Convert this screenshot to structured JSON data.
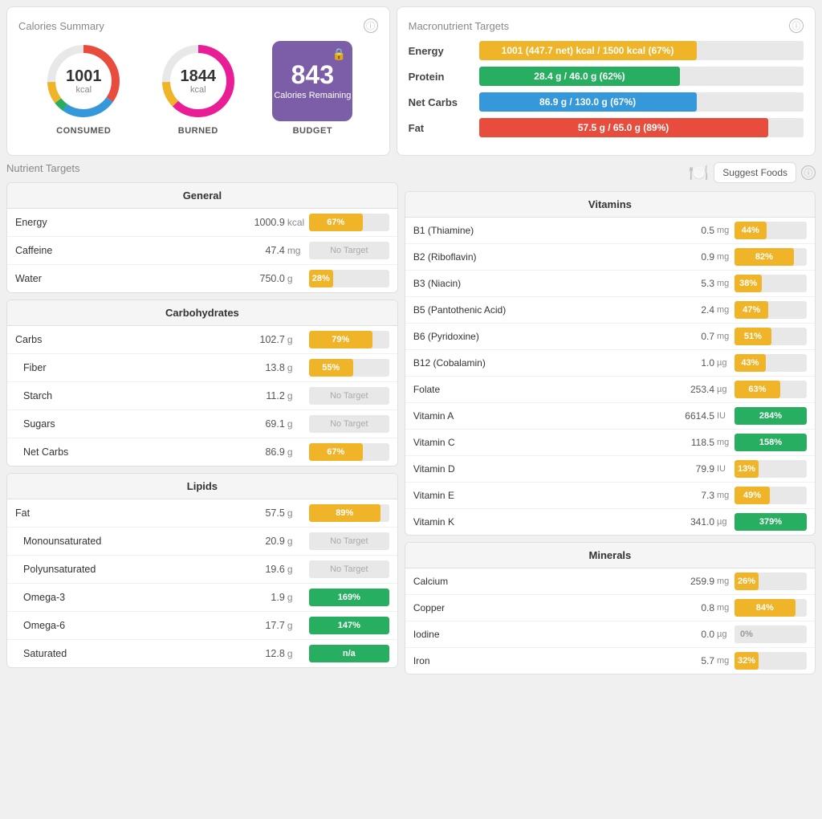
{
  "calories_summary": {
    "title": "Calories Summary",
    "info": "i",
    "consumed": {
      "value": "1001",
      "unit": "kcal",
      "label": "CONSUMED"
    },
    "burned": {
      "value": "1844",
      "unit": "kcal",
      "label": "BURNED"
    },
    "budget": {
      "value": "843",
      "text": "Calories Remaining",
      "label": "BUDGET"
    }
  },
  "macronutrient_targets": {
    "title": "Macronutrient Targets",
    "info": "i",
    "rows": [
      {
        "label": "Energy",
        "text": "1001 (447.7 net) kcal / 1500 kcal (67%)",
        "pct": 67,
        "color": "#f0b429"
      },
      {
        "label": "Protein",
        "text": "28.4 g / 46.0 g (62%)",
        "pct": 62,
        "color": "#27ae60"
      },
      {
        "label": "Net Carbs",
        "text": "86.9 g / 130.0 g (67%)",
        "pct": 67,
        "color": "#3498db"
      },
      {
        "label": "Fat",
        "text": "57.5 g / 65.0 g (89%)",
        "pct": 89,
        "color": "#e74c3c"
      }
    ]
  },
  "nutrient_targets": {
    "title": "Nutrient Targets",
    "suggest_foods": "Suggest Foods",
    "general": {
      "header": "General",
      "rows": [
        {
          "name": "Energy",
          "value": "1000.9",
          "unit": "kcal",
          "pct": 67,
          "color": "#f0b429",
          "indented": false
        },
        {
          "name": "Caffeine",
          "value": "47.4",
          "unit": "mg",
          "no_target": true,
          "indented": false
        },
        {
          "name": "Water",
          "value": "750.0",
          "unit": "g",
          "pct": 28,
          "color": "#f0b429",
          "indented": false
        }
      ]
    },
    "carbohydrates": {
      "header": "Carbohydrates",
      "rows": [
        {
          "name": "Carbs",
          "value": "102.7",
          "unit": "g",
          "pct": 79,
          "color": "#f0b429",
          "indented": false
        },
        {
          "name": "Fiber",
          "value": "13.8",
          "unit": "g",
          "pct": 55,
          "color": "#f0b429",
          "indented": true
        },
        {
          "name": "Starch",
          "value": "11.2",
          "unit": "g",
          "no_target": true,
          "indented": true
        },
        {
          "name": "Sugars",
          "value": "69.1",
          "unit": "g",
          "no_target": true,
          "indented": true
        },
        {
          "name": "Net Carbs",
          "value": "86.9",
          "unit": "g",
          "pct": 67,
          "color": "#f0b429",
          "indented": true
        }
      ]
    },
    "lipids": {
      "header": "Lipids",
      "rows": [
        {
          "name": "Fat",
          "value": "57.5",
          "unit": "g",
          "pct": 89,
          "color": "#f0b429",
          "indented": false
        },
        {
          "name": "Monounsaturated",
          "value": "20.9",
          "unit": "g",
          "no_target": true,
          "indented": true
        },
        {
          "name": "Polyunsaturated",
          "value": "19.6",
          "unit": "g",
          "no_target": true,
          "indented": true
        },
        {
          "name": "Omega-3",
          "value": "1.9",
          "unit": "g",
          "pct": 169,
          "color": "#27ae60",
          "indented": true
        },
        {
          "name": "Omega-6",
          "value": "17.7",
          "unit": "g",
          "pct": 147,
          "color": "#27ae60",
          "indented": true
        },
        {
          "name": "Saturated",
          "value": "12.8",
          "unit": "g",
          "na": true,
          "color": "#27ae60",
          "indented": true
        }
      ]
    }
  },
  "vitamins": {
    "header": "Vitamins",
    "rows": [
      {
        "name": "B1 (Thiamine)",
        "value": "0.5",
        "unit": "mg",
        "pct": 44,
        "color": "#f0b429"
      },
      {
        "name": "B2 (Riboflavin)",
        "value": "0.9",
        "unit": "mg",
        "pct": 82,
        "color": "#f0b429"
      },
      {
        "name": "B3 (Niacin)",
        "value": "5.3",
        "unit": "mg",
        "pct": 38,
        "color": "#f0b429"
      },
      {
        "name": "B5 (Pantothenic Acid)",
        "value": "2.4",
        "unit": "mg",
        "pct": 47,
        "color": "#f0b429"
      },
      {
        "name": "B6 (Pyridoxine)",
        "value": "0.7",
        "unit": "mg",
        "pct": 51,
        "color": "#f0b429"
      },
      {
        "name": "B12 (Cobalamin)",
        "value": "1.0",
        "unit": "µg",
        "pct": 43,
        "color": "#f0b429"
      },
      {
        "name": "Folate",
        "value": "253.4",
        "unit": "µg",
        "pct": 63,
        "color": "#f0b429"
      },
      {
        "name": "Vitamin A",
        "value": "6614.5",
        "unit": "IU",
        "pct": 284,
        "color": "#27ae60"
      },
      {
        "name": "Vitamin C",
        "value": "118.5",
        "unit": "mg",
        "pct": 158,
        "color": "#27ae60"
      },
      {
        "name": "Vitamin D",
        "value": "79.9",
        "unit": "IU",
        "pct": 13,
        "color": "#f0b429"
      },
      {
        "name": "Vitamin E",
        "value": "7.3",
        "unit": "mg",
        "pct": 49,
        "color": "#f0b429"
      },
      {
        "name": "Vitamin K",
        "value": "341.0",
        "unit": "µg",
        "pct": 379,
        "color": "#27ae60"
      }
    ]
  },
  "minerals": {
    "header": "Minerals",
    "rows": [
      {
        "name": "Calcium",
        "value": "259.9",
        "unit": "mg",
        "pct": 26,
        "color": "#f0b429"
      },
      {
        "name": "Copper",
        "value": "0.8",
        "unit": "mg",
        "pct": 84,
        "color": "#f0b429"
      },
      {
        "name": "Iodine",
        "value": "0.0",
        "unit": "µg",
        "pct": 0,
        "color": "#e8e8e8"
      },
      {
        "name": "Iron",
        "value": "5.7",
        "unit": "mg",
        "pct": 32,
        "color": "#f0b429"
      }
    ]
  },
  "icons": {
    "info": "ⓘ",
    "budget_lock": "🔒",
    "suggest_emoji": "🍽️"
  }
}
